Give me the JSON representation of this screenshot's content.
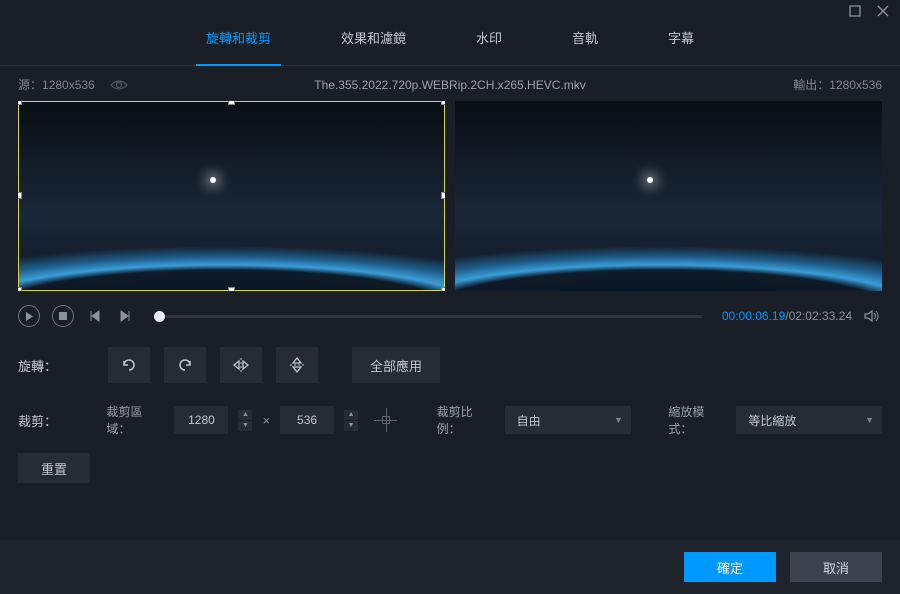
{
  "tabs": {
    "rotate_crop": "旋轉和裁剪",
    "effects_filters": "效果和濾鏡",
    "watermark": "水印",
    "audio": "音軌",
    "subtitle": "字幕"
  },
  "meta": {
    "source_label": "源：",
    "source_res": "1280x536",
    "filename": "The.355.2022.720p.WEBRip.2CH.x265.HEVC.mkv",
    "output_label": "輸出：",
    "output_res": "1280x536"
  },
  "playback": {
    "current": "00:00:06.19",
    "sep": "/",
    "duration": "02:02:33.24"
  },
  "rotate": {
    "label": "旋轉：",
    "apply_all": "全部應用"
  },
  "crop": {
    "label": "裁剪：",
    "area_label": "裁剪區域：",
    "width": "1280",
    "height": "536",
    "ratio_label": "裁剪比例：",
    "ratio_value": "自由",
    "zoom_label": "縮放模式：",
    "zoom_value": "等比縮放"
  },
  "reset": "重置",
  "footer": {
    "ok": "確定",
    "cancel": "取消"
  },
  "icons": {
    "maximize": "maximize-icon",
    "close": "close-icon",
    "eye": "eye-icon",
    "play": "play-icon",
    "stop": "stop-icon",
    "prev_frame": "prev-frame-icon",
    "next_frame": "next-frame-icon",
    "volume": "volume-icon",
    "rotate_left": "rotate-left-icon",
    "rotate_right": "rotate-right-icon",
    "flip_h": "flip-horizontal-icon",
    "flip_v": "flip-vertical-icon",
    "chevron_down": "chevron-down-icon"
  }
}
